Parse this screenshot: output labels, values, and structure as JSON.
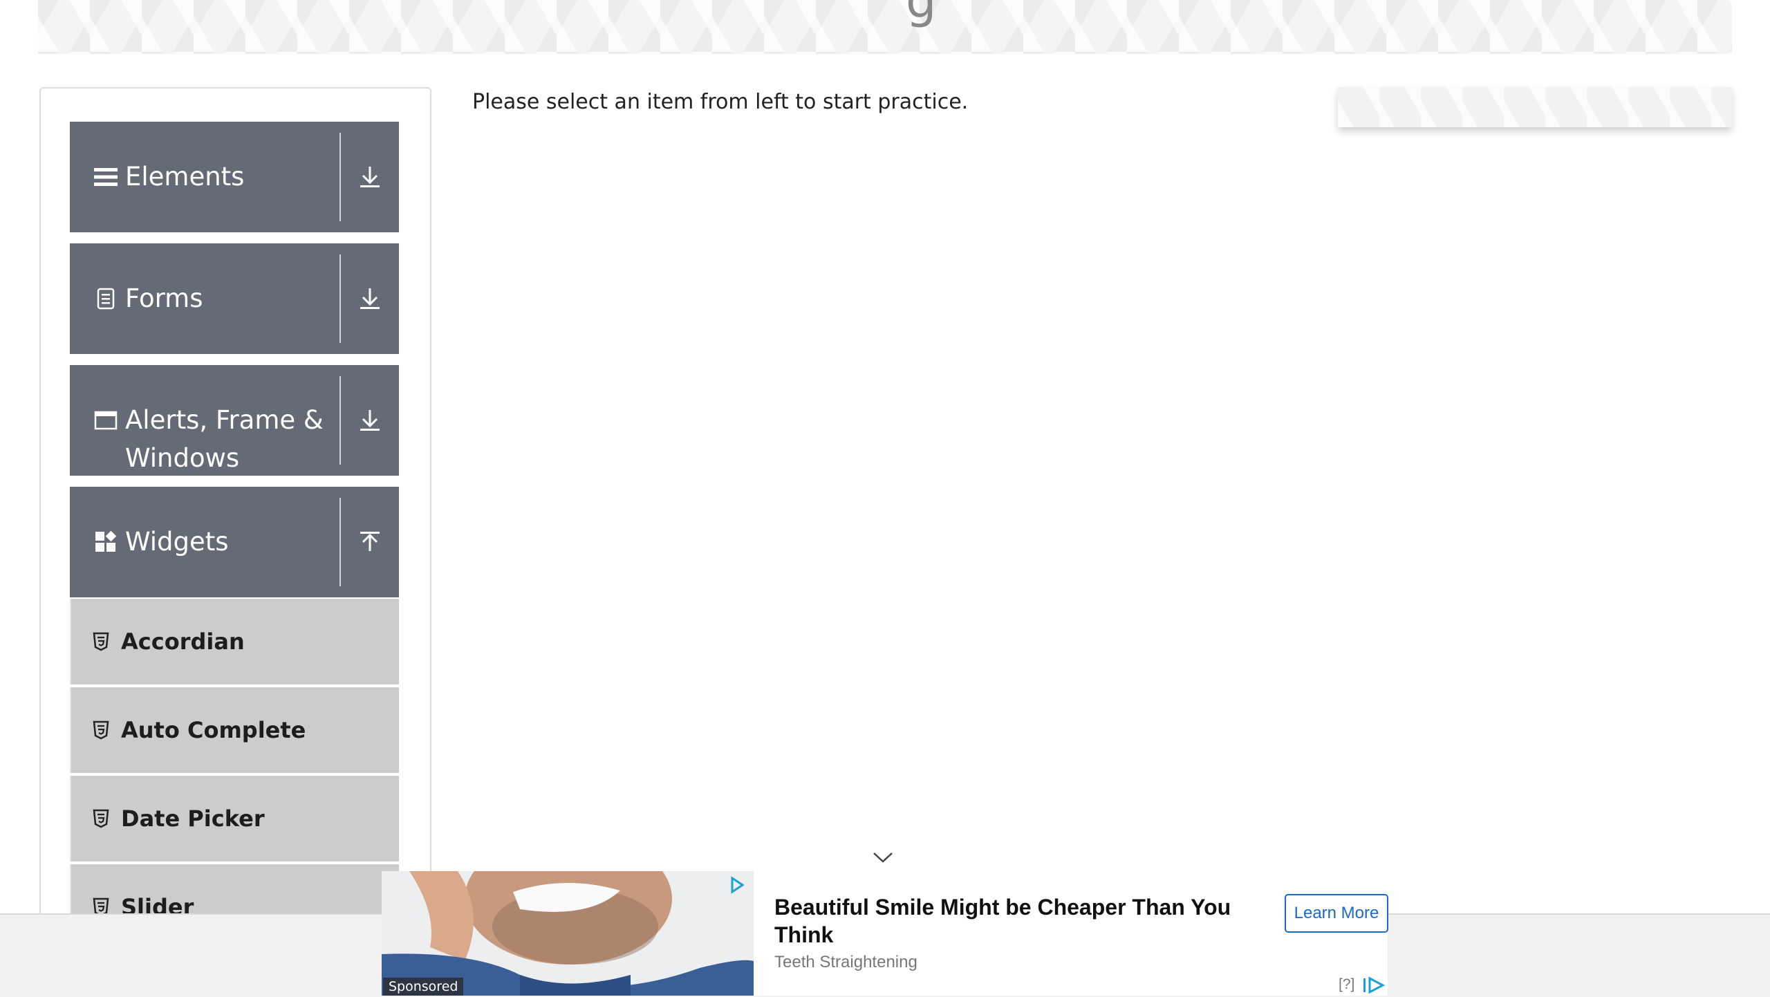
{
  "header": {
    "title_fragment": "g"
  },
  "nav": {
    "groups": [
      {
        "label": "Elements",
        "icon": "hamburger-icon",
        "toggle_icon": "arrow-down-icon"
      },
      {
        "label": "Forms",
        "icon": "document-icon",
        "toggle_icon": "arrow-down-icon"
      },
      {
        "label": "Alerts, Frame & Windows",
        "label_line1": "Alerts, Frame &",
        "label_line2": "Windows",
        "icon": "window-icon",
        "toggle_icon": "arrow-down-icon"
      },
      {
        "label": "Widgets",
        "icon": "widgets-icon",
        "toggle_icon": "arrow-up-icon"
      }
    ],
    "widgets_items": [
      "Accordian",
      "Auto Complete",
      "Date Picker",
      "Slider"
    ]
  },
  "main": {
    "instruction": "Please select an item from left to start practice."
  },
  "ad": {
    "badge": "Sponsored",
    "headline": "Beautiful Smile Might be Cheaper Than You Think",
    "subtext": "Teeth Straightening",
    "cta_label": "Learn More",
    "help_label": "[?]"
  },
  "colors": {
    "group_header_bg": "#646b76",
    "menu_item_bg": "#cccccc",
    "cta_accent": "#1a6ac7"
  }
}
